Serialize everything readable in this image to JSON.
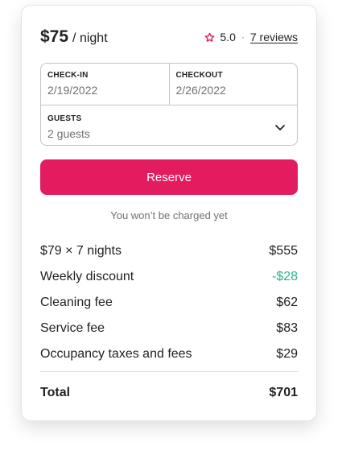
{
  "header": {
    "price": "$75",
    "per_night": "/ night",
    "rating": "5.0",
    "separator": "·",
    "reviews_link": "7 reviews"
  },
  "picker": {
    "checkin_label": "CHECK-IN",
    "checkin_value": "2/19/2022",
    "checkout_label": "CHECKOUT",
    "checkout_value": "2/26/2022",
    "guests_label": "GUESTS",
    "guests_value": "2 guests"
  },
  "reserve_button": "Reserve",
  "charge_note": "You won’t be charged yet",
  "fees": [
    {
      "label": "$79 × 7 nights",
      "amount": "$555"
    },
    {
      "label": "Weekly discount",
      "amount": "-$28"
    },
    {
      "label": "Cleaning fee",
      "amount": "$62"
    },
    {
      "label": "Service fee",
      "amount": "$83"
    },
    {
      "label": "Occupancy taxes and fees",
      "amount": "$29"
    }
  ],
  "total": {
    "label": "Total",
    "amount": "$701"
  },
  "colors": {
    "accent": "#e31c5f",
    "discount": "#2db38b",
    "muted_text": "#717171"
  },
  "icons": {
    "rating": "star-icon",
    "guests_dropdown": "chevron-down-icon"
  }
}
